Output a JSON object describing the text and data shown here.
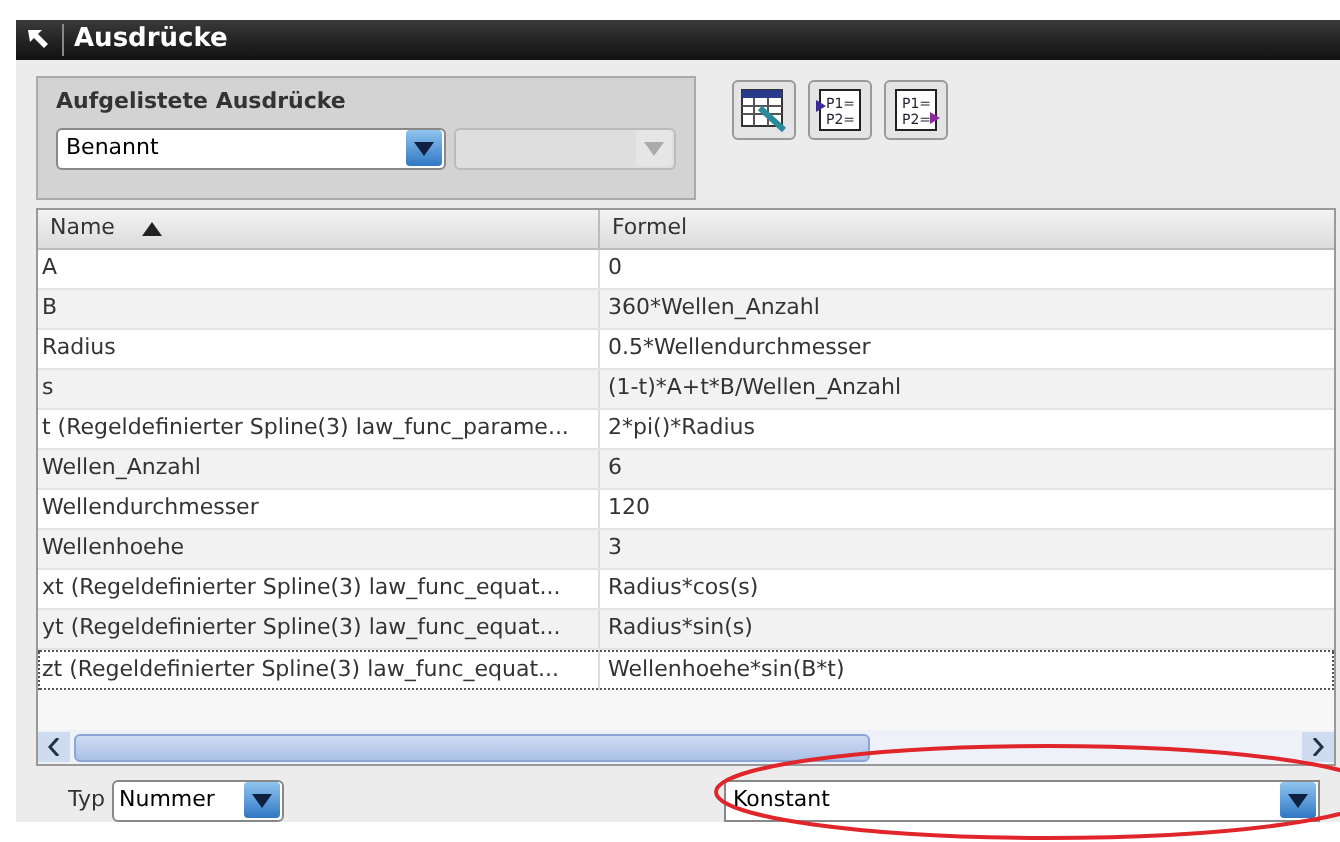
{
  "window": {
    "title": "Ausdrücke"
  },
  "listed": {
    "title": "Aufgelistete Ausdrücke",
    "filter": "Benannt",
    "filter_2_disabled": true
  },
  "toolbar": [
    {
      "kind": "spreadsheet"
    },
    {
      "kind": "import",
      "lines": [
        "P1=",
        "P2="
      ]
    },
    {
      "kind": "export",
      "lines": [
        "P1=",
        "P2="
      ]
    }
  ],
  "table": {
    "columns": [
      {
        "label": "Name",
        "sorted": true
      },
      {
        "label": "Formel",
        "sorted": false
      }
    ],
    "rows": [
      {
        "name": "A",
        "formula": "0",
        "selected": false
      },
      {
        "name": "B",
        "formula": "360*Wellen_Anzahl",
        "selected": false
      },
      {
        "name": "Radius",
        "formula": "0.5*Wellendurchmesser",
        "selected": false
      },
      {
        "name": "s",
        "formula": "(1-t)*A+t*B/Wellen_Anzahl",
        "selected": false
      },
      {
        "name": "t  (Regeldefinierter Spline(3) law_func_parame...",
        "formula": "2*pi()*Radius",
        "selected": false
      },
      {
        "name": "Wellen_Anzahl",
        "formula": "6",
        "selected": false
      },
      {
        "name": "Wellendurchmesser",
        "formula": "120",
        "selected": false
      },
      {
        "name": "Wellenhoehe",
        "formula": "3",
        "selected": false
      },
      {
        "name": "xt  (Regeldefinierter Spline(3) law_func_equat...",
        "formula": "Radius*cos(s)",
        "selected": false
      },
      {
        "name": "yt  (Regeldefinierter Spline(3) law_func_equat...",
        "formula": "Radius*sin(s)",
        "selected": false
      },
      {
        "name": "zt  (Regeldefinierter Spline(3) law_func_equat...",
        "formula": "Wellenhoehe*sin(B*t)",
        "selected": true
      }
    ]
  },
  "bottom": {
    "type_label": "Typ",
    "type_value": "Nummer",
    "unit_value": "Konstant",
    "highlighted": true
  }
}
